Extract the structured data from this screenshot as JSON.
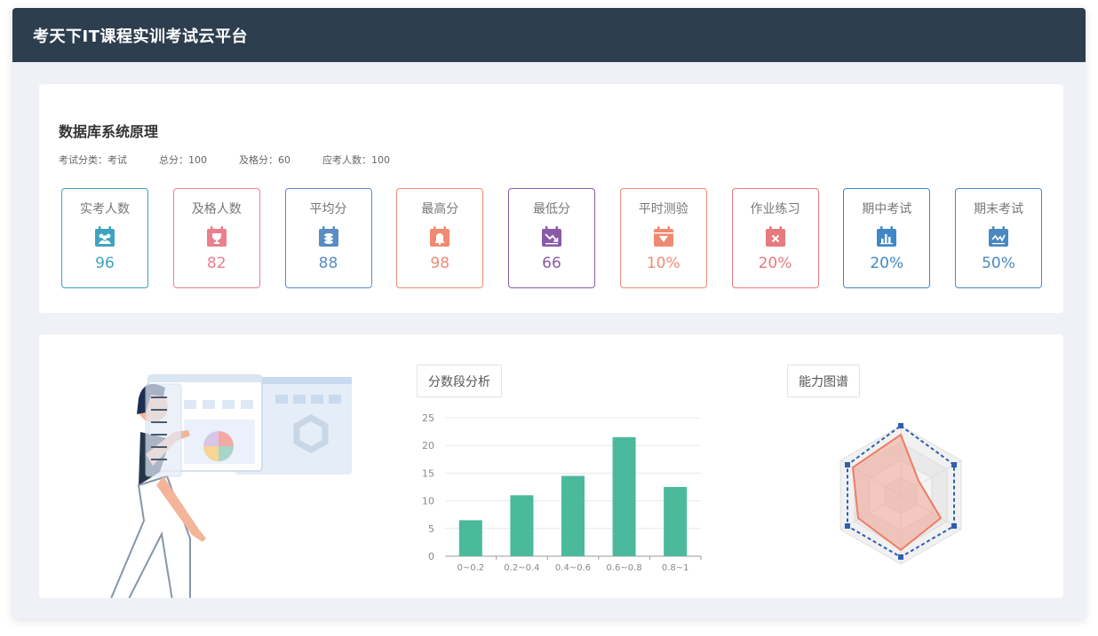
{
  "app": {
    "title": "考天下IT课程实训考试云平台"
  },
  "course": {
    "title": "数据库系统原理",
    "meta": [
      {
        "label": "考试分类：",
        "value": "考试"
      },
      {
        "label": "总分：",
        "value": "100"
      },
      {
        "label": "及格分：",
        "value": "60"
      },
      {
        "label": "应考人数：",
        "value": "100"
      }
    ]
  },
  "stats": [
    {
      "label": "实考人数",
      "value": "96",
      "color": "#3fa3bf",
      "icon": "people-icon"
    },
    {
      "label": "及格人数",
      "value": "82",
      "color": "#ec7f8c",
      "icon": "trophy-icon"
    },
    {
      "label": "平均分",
      "value": "88",
      "color": "#5a8cc6",
      "icon": "coins-icon"
    },
    {
      "label": "最高分",
      "value": "98",
      "color": "#ef8a72",
      "icon": "bell-icon"
    },
    {
      "label": "最低分",
      "value": "66",
      "color": "#8a5aa8",
      "icon": "trend-down-icon"
    },
    {
      "label": "平时测验",
      "value": "10%",
      "color": "#ef8a72",
      "icon": "heart-icon"
    },
    {
      "label": "作业练习",
      "value": "20%",
      "color": "#e77a7a",
      "icon": "cross-icon"
    },
    {
      "label": "期中考试",
      "value": "20%",
      "color": "#3f88c8",
      "icon": "bar-icon"
    },
    {
      "label": "期末考试",
      "value": "50%",
      "color": "#4a88c0",
      "icon": "line-icon"
    }
  ],
  "tabs": {
    "score": "分数段分析",
    "radar": "能力图谱"
  },
  "colors": {
    "bar": "#4bb99b",
    "radar_fill": "#f3a593",
    "radar_dash": "#2d5fb0"
  },
  "chart_data": {
    "type": "bar",
    "categories": [
      "0~0.2",
      "0.2~0.4",
      "0.4~0.6",
      "0.6~0.8",
      "0.8~1"
    ],
    "values": [
      6.5,
      11,
      14.5,
      21.5,
      12.5
    ],
    "yticks": [
      0,
      5,
      10,
      15,
      20,
      25
    ],
    "ylim": [
      0,
      25
    ],
    "grid": true
  }
}
